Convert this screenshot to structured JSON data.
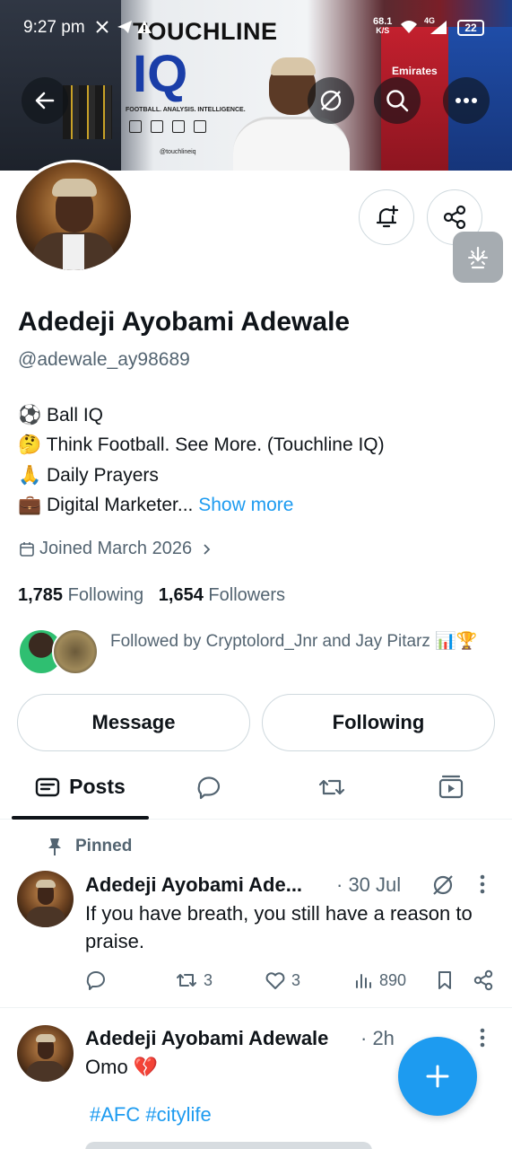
{
  "status_bar": {
    "time": "9:27 pm",
    "net_speed_value": "68.1",
    "net_speed_unit": "K/S",
    "network": "4G",
    "battery": "22"
  },
  "banner": {
    "brand_title": "TOUCHLINE",
    "brand_logo": "IQ",
    "brand_tagline": "FOOTBALL. ANALYSIS. INTELLIGENCE.",
    "jersey_sponsor": "Emirates",
    "social_handle": "@touchlineiq"
  },
  "profile": {
    "name": "Adedeji Ayobami Adewale",
    "handle": "@adewale_ay98689",
    "bio": [
      {
        "emoji": "⚽",
        "text": "Ball IQ"
      },
      {
        "emoji": "🤔",
        "text": "Think Football. See More. (Touchline IQ)"
      },
      {
        "emoji": "🙏",
        "text": "Daily Prayers"
      },
      {
        "emoji": "💼",
        "text": "Digital Marketer..."
      }
    ],
    "show_more": "Show more",
    "joined": "Joined March 2026",
    "following_count": "1,785",
    "following_label": "Following",
    "followers_count": "1,654",
    "followers_label": "Followers",
    "followed_by": "Followed by Cryptolord_Jnr and Jay Pitarz 📊🏆"
  },
  "buttons": {
    "message": "Message",
    "following": "Following"
  },
  "tabs": {
    "posts": "Posts"
  },
  "posts": [
    {
      "pinned_label": "Pinned",
      "author": "Adedeji Ayobami Ade...",
      "time": "· 30 Jul",
      "text": "If you have breath, you still have a reason to praise.",
      "replies": "",
      "reposts": "3",
      "likes": "3",
      "views": "890"
    },
    {
      "author": "Adedeji Ayobami Adewale",
      "time": "· 2h",
      "text": "Omo 💔",
      "tags": "#AFC #citylife"
    }
  ],
  "colors": {
    "accent": "#1d9bf0",
    "text_primary": "#0f1419",
    "text_secondary": "#536471",
    "border": "#cfd9de"
  }
}
